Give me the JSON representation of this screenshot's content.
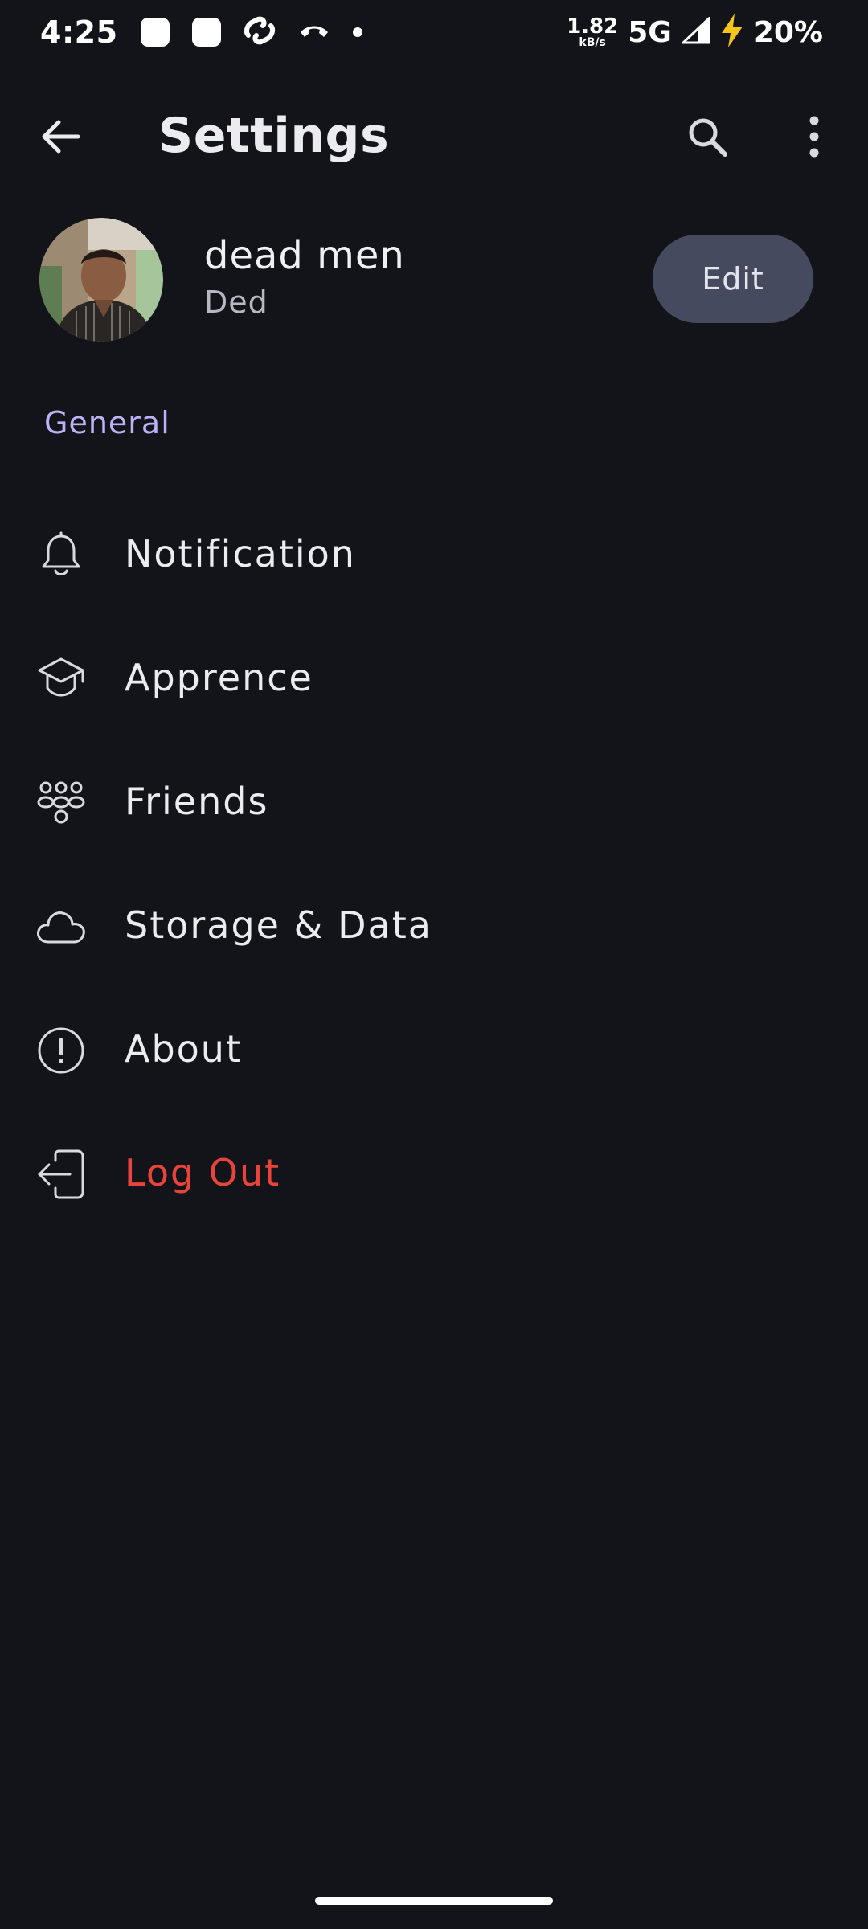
{
  "status_bar": {
    "time": "4:25",
    "net_speed_value": "1.82",
    "net_speed_unit": "kB/s",
    "network": "5G",
    "battery": "20%"
  },
  "app_bar": {
    "title": "Settings"
  },
  "profile": {
    "name": "dead men",
    "username": "Ded",
    "edit_label": "Edit"
  },
  "section": {
    "general_label": "General"
  },
  "menu": {
    "items": [
      {
        "label": "Notification",
        "icon": "bell-icon"
      },
      {
        "label": "Apprence",
        "icon": "graduation-cap-icon"
      },
      {
        "label": "Friends",
        "icon": "users-icon"
      },
      {
        "label": "Storage & Data",
        "icon": "cloud-icon"
      },
      {
        "label": "About",
        "icon": "info-circle-icon"
      },
      {
        "label": "Log Out",
        "icon": "logout-icon"
      }
    ]
  },
  "colors": {
    "background": "#131419",
    "accent": "#b9b4f6",
    "danger": "#e9443b",
    "button": "#464a5e"
  }
}
